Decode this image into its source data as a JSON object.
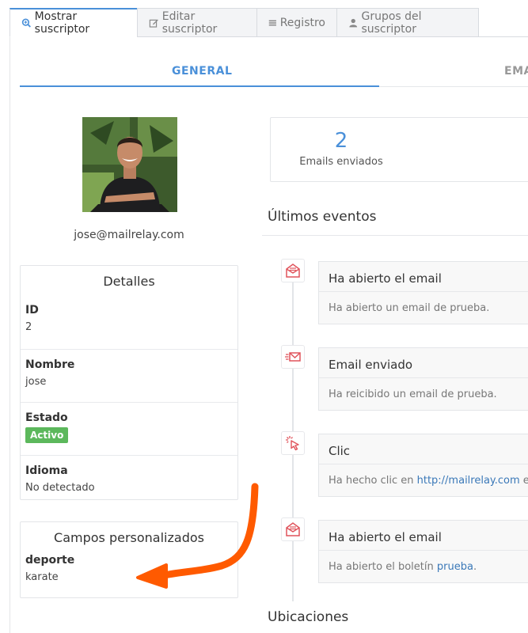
{
  "tabs": [
    {
      "label": "Mostrar suscriptor",
      "icon": "zoom-icon",
      "active": true
    },
    {
      "label": "Editar suscriptor",
      "icon": "edit-icon",
      "active": false
    },
    {
      "label": "Registro",
      "icon": "list-icon",
      "active": false
    },
    {
      "label": "Grupos del suscriptor",
      "icon": "user-icon",
      "active": false
    }
  ],
  "subtabs": {
    "general": "GENERAL",
    "emails": "EMA"
  },
  "profile": {
    "email": "jose@mailrelay.com"
  },
  "details": {
    "title": "Detalles",
    "id_label": "ID",
    "id_value": "2",
    "name_label": "Nombre",
    "name_value": "jose",
    "status_label": "Estado",
    "status_value": "Activo",
    "lang_label": "Idioma",
    "lang_value": "No detectado"
  },
  "custom": {
    "title": "Campos personalizados",
    "field_label": "deporte",
    "field_value": "karate"
  },
  "stats": {
    "count": "2",
    "label": "Emails enviados"
  },
  "events_title": "Últimos eventos",
  "events": [
    {
      "icon": "open-envelope-icon",
      "title": "Ha abierto el email",
      "desc": "Ha abierto un email de prueba.",
      "link": "",
      "tail": ""
    },
    {
      "icon": "send-envelope-icon",
      "title": "Email enviado",
      "desc": "Ha reicibido un email de prueba.",
      "link": "",
      "tail": ""
    },
    {
      "icon": "click-cursor-icon",
      "title": "Clic",
      "desc": "Ha hecho clic en ",
      "link": "http://mailrelay.com",
      "tail": " en e"
    },
    {
      "icon": "open-envelope-icon",
      "title": "Ha abierto el email",
      "desc": "Ha abierto el boletín ",
      "link": "prueba",
      "tail": "."
    }
  ],
  "locations_title": "Ubicaciones",
  "colors": {
    "accent": "#4a90d9",
    "success": "#5cb85c",
    "event_icon": "#e0535b",
    "annotation_arrow": "#ff5a00"
  }
}
